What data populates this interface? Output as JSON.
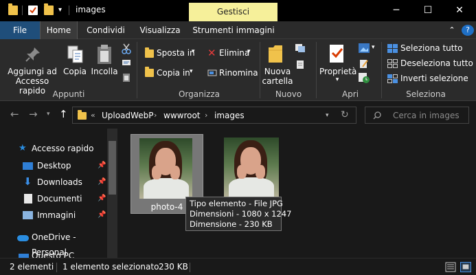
{
  "window": {
    "title": "images",
    "context_tab": "Gestisci",
    "minimize": "─",
    "maximize": "☐",
    "close": "✕"
  },
  "tabs": {
    "file": "File",
    "home": "Home",
    "condividi": "Condividi",
    "visualizza": "Visualizza",
    "strumenti": "Strumenti immagini",
    "collapse": "⌃",
    "help": "?"
  },
  "ribbon": {
    "appunti": {
      "label": "Appunti",
      "pin_line1": "Aggiungi ad",
      "pin_line2": "Accesso rapido",
      "copia": "Copia",
      "incolla": "Incolla"
    },
    "organizza": {
      "label": "Organizza",
      "sposta": "Sposta in",
      "copia_in": "Copia in",
      "elimina": "Elimina",
      "rinomina": "Rinomina"
    },
    "nuovo": {
      "label": "Nuovo",
      "nuova_line1": "Nuova",
      "nuova_line2": "cartella"
    },
    "apri": {
      "label": "Apri",
      "proprieta": "Proprietà"
    },
    "seleziona": {
      "label": "Seleziona",
      "tutto": "Seleziona tutto",
      "deseleziona": "Deseleziona tutto",
      "inverti": "Inverti selezione"
    }
  },
  "address": {
    "overflow": "«",
    "crumbs": [
      "UploadWebP",
      "wwwroot",
      "images"
    ],
    "search_placeholder": "Cerca in images"
  },
  "nav": {
    "quick_access": "Accesso rapido",
    "items": [
      "Desktop",
      "Downloads",
      "Documenti",
      "Immagini"
    ],
    "onedrive": "OneDrive - Personal",
    "questo_pc": "Questo PC"
  },
  "files": [
    {
      "name": "photo-4",
      "selected": true
    },
    {
      "name": "",
      "selected": false
    }
  ],
  "tooltip": {
    "type": "Tipo elemento - File JPG",
    "dims": "Dimensioni - 1080 x 1247",
    "size": "Dimensione - 230 KB"
  },
  "status": {
    "count": "2 elementi",
    "selected": "1 elemento selezionato",
    "size": "230 KB"
  },
  "colors": {
    "accent": "#1f4e7a",
    "context_tab": "#f6f09a",
    "folder": "#f0c24b"
  }
}
